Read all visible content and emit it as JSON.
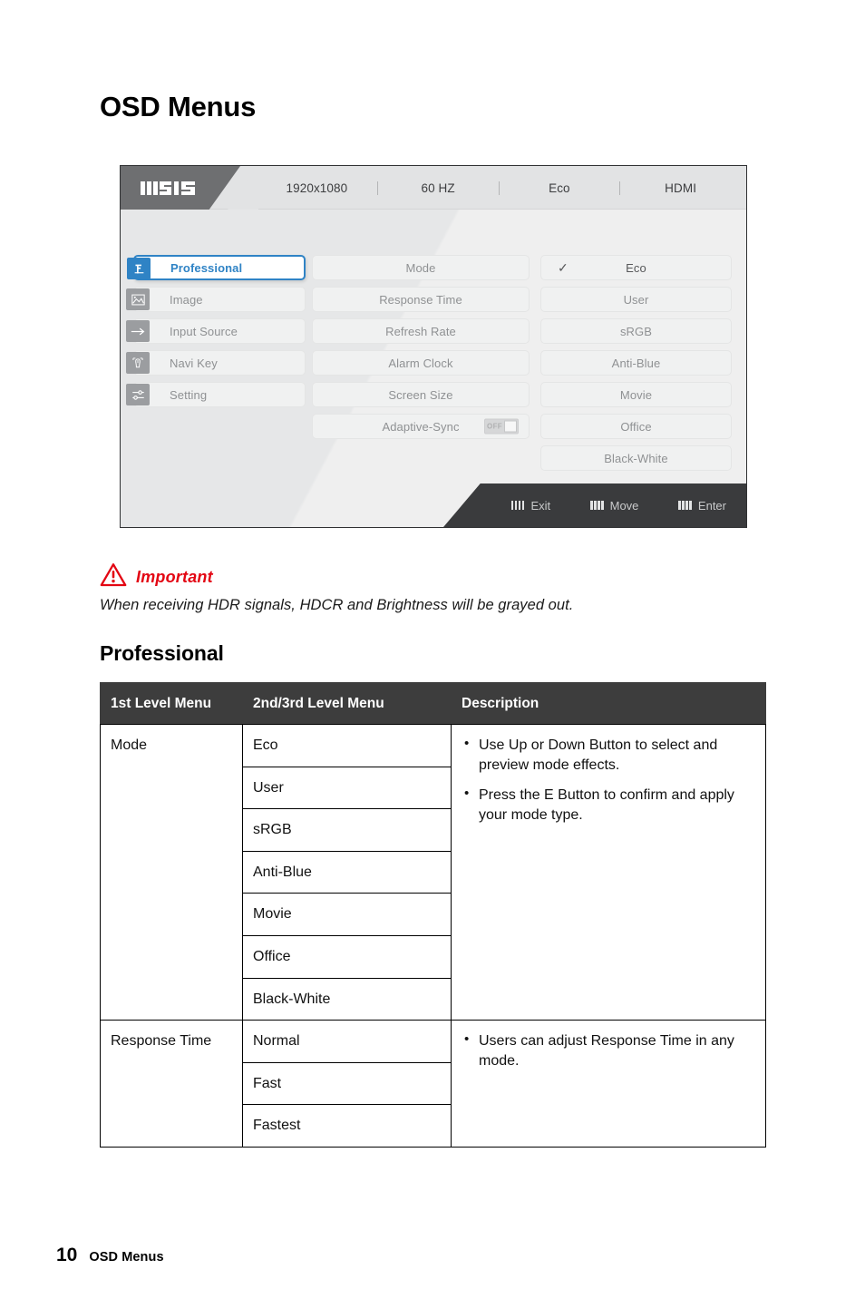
{
  "page": {
    "title": "OSD Menus",
    "footer_page_number": "10",
    "footer_label": "OSD Menus"
  },
  "osd": {
    "logo": "msi-logo",
    "status": [
      {
        "label": "1920x1080"
      },
      {
        "label": "60 HZ"
      },
      {
        "label": "Eco"
      },
      {
        "label": "HDMI"
      }
    ],
    "left_menu": [
      {
        "label": "Professional",
        "icon": "professional-icon",
        "selected": true
      },
      {
        "label": "Image",
        "icon": "image-icon",
        "selected": false
      },
      {
        "label": "Input Source",
        "icon": "input-source-icon",
        "selected": false
      },
      {
        "label": "Navi Key",
        "icon": "navi-key-icon",
        "selected": false
      },
      {
        "label": "Setting",
        "icon": "setting-icon",
        "selected": false
      }
    ],
    "mid_menu": [
      {
        "label": "Mode"
      },
      {
        "label": "Response Time"
      },
      {
        "label": "Refresh Rate"
      },
      {
        "label": "Alarm Clock"
      },
      {
        "label": "Screen Size"
      },
      {
        "label": "Adaptive-Sync",
        "toggle": "OFF"
      }
    ],
    "right_menu": [
      {
        "label": "Eco",
        "checked": true
      },
      {
        "label": "User",
        "checked": false
      },
      {
        "label": "sRGB",
        "checked": false
      },
      {
        "label": "Anti-Blue",
        "checked": false
      },
      {
        "label": "Movie",
        "checked": false
      },
      {
        "label": "Office",
        "checked": false
      },
      {
        "label": "Black-White",
        "checked": false
      }
    ],
    "footer_actions": [
      {
        "label": "Exit",
        "icon": "nav-bars-icon"
      },
      {
        "label": "Move",
        "icon": "nav-bars-icon"
      },
      {
        "label": "Enter",
        "icon": "nav-bars-icon"
      }
    ]
  },
  "important": {
    "icon": "warning-triangle-icon",
    "label": "Important",
    "text": "When receiving HDR signals, HDCR and Brightness will be grayed out."
  },
  "section": {
    "title": "Professional"
  },
  "table": {
    "headers": [
      "1st Level Menu",
      "2nd/3rd Level Menu",
      "Description"
    ],
    "groups": [
      {
        "name": "Mode",
        "items": [
          "Eco",
          "User",
          "sRGB",
          "Anti-Blue",
          "Movie",
          "Office",
          "Black-White"
        ],
        "description": [
          "Use Up or Down Button to select and preview mode effects.",
          "Press the E Button to confirm and apply your mode type."
        ]
      },
      {
        "name": "Response Time",
        "items": [
          "Normal",
          "Fast",
          "Fastest"
        ],
        "description": [
          "Users can adjust Response Time in any mode."
        ]
      }
    ]
  },
  "colors": {
    "accent_blue": "#2f83c5",
    "warning_red": "#e30613",
    "header_dark": "#3d3d3d",
    "osd_footer_dark": "#3a3b3d"
  }
}
